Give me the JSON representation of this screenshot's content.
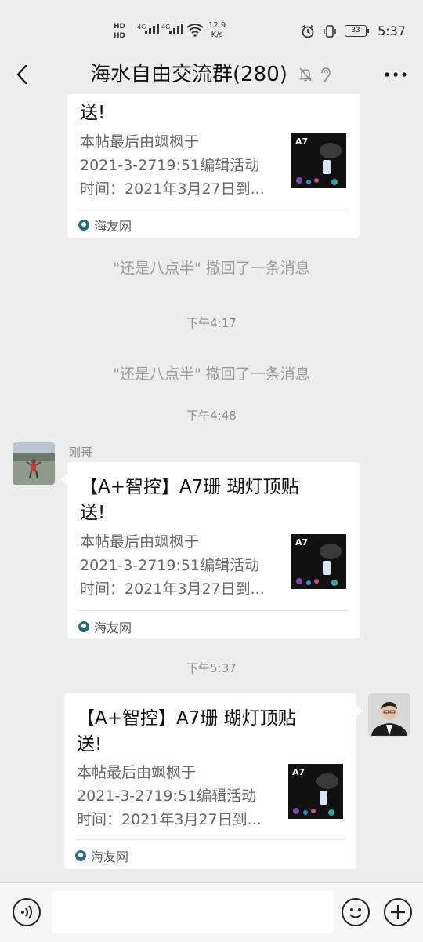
{
  "status_bar": {
    "network_labels": [
      "HD",
      "HD",
      "4G",
      "4G"
    ],
    "speed_value": "12.9",
    "speed_unit": "K/s",
    "battery": "33",
    "time": "5:37"
  },
  "header": {
    "title": "海水自由交流群(280)"
  },
  "messages": {
    "card1": {
      "title": "送!",
      "desc_lines": [
        "本帖最后由飒枫于",
        "2021-3-2719:51编辑活动",
        "时间：2021年3月27日到..."
      ],
      "source": "海友网",
      "thumb_label": "A7"
    },
    "recall1": "\"还是八点半\" 撤回了一条消息",
    "time1": "下午4:17",
    "recall2": "\"还是八点半\" 撤回了一条消息",
    "time2": "下午4:48",
    "sender2": "刚哥",
    "card2": {
      "title_line1": "【A+智控】A7珊 瑚灯顶贴",
      "title_line2": "送!",
      "desc_lines": [
        "本帖最后由飒枫于",
        "2021-3-2719:51编辑活动",
        "时间：2021年3月27日到..."
      ],
      "source": "海友网",
      "thumb_label": "A7"
    },
    "time3": "下午5:37",
    "card3": {
      "title_line1": "【A+智控】A7珊 瑚灯顶贴",
      "title_line2": "送!",
      "desc_lines": [
        "本帖最后由飒枫于",
        "2021-3-2719:51编辑活动",
        "时间：2021年3月27日到..."
      ],
      "source": "海友网",
      "thumb_label": "A7"
    }
  },
  "input": {
    "value": ""
  }
}
